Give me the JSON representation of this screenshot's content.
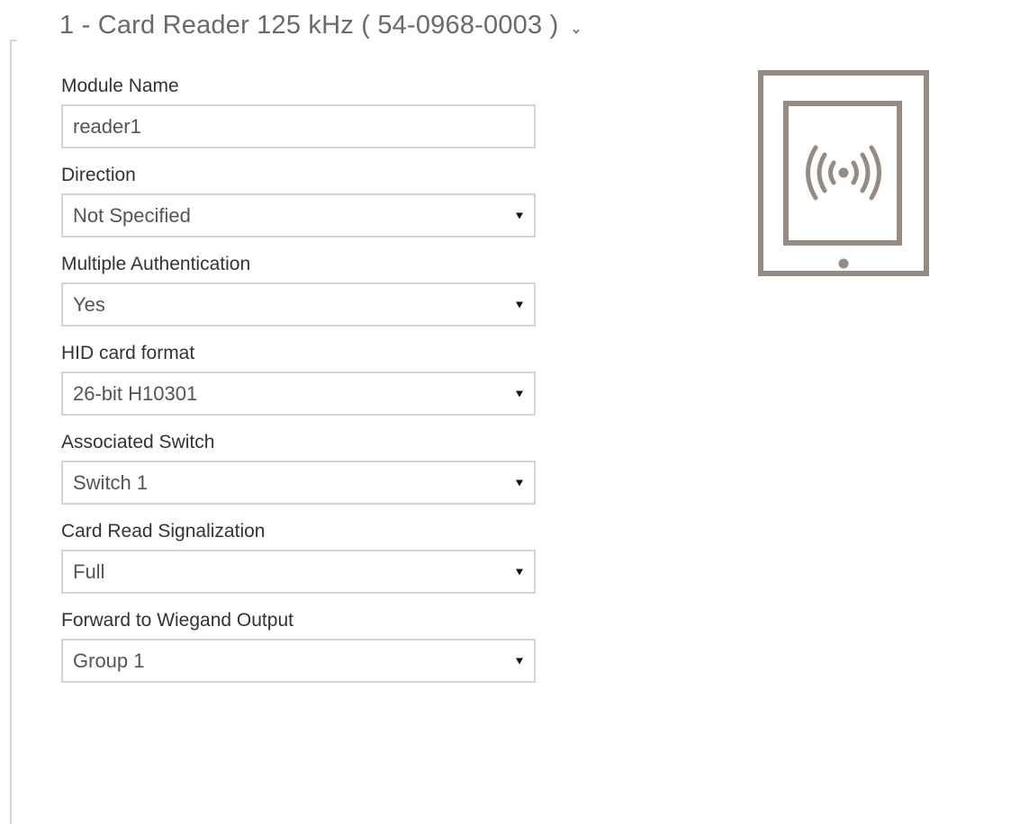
{
  "section": {
    "title": "1 - Card Reader 125 kHz ( 54-0968-0003 )",
    "toggle_icon": "chevron-down-icon"
  },
  "form": {
    "module_name": {
      "label": "Module Name",
      "value": "reader1"
    },
    "direction": {
      "label": "Direction",
      "value": "Not Specified"
    },
    "multiple_authentication": {
      "label": "Multiple Authentication",
      "value": "Yes"
    },
    "hid_card_format": {
      "label": "HID card format",
      "value": "26-bit H10301"
    },
    "associated_switch": {
      "label": "Associated Switch",
      "value": "Switch 1"
    },
    "card_read_signalization": {
      "label": "Card Read Signalization",
      "value": "Full"
    },
    "forward_to_wiegand_output": {
      "label": "Forward to Wiegand Output",
      "value": "Group 1"
    }
  },
  "device_image": {
    "icon": "rfid-card-reader-icon"
  },
  "colors": {
    "device_stroke": "#958b82",
    "title_text": "#6a6a6a",
    "border": "#d4d4d4"
  }
}
